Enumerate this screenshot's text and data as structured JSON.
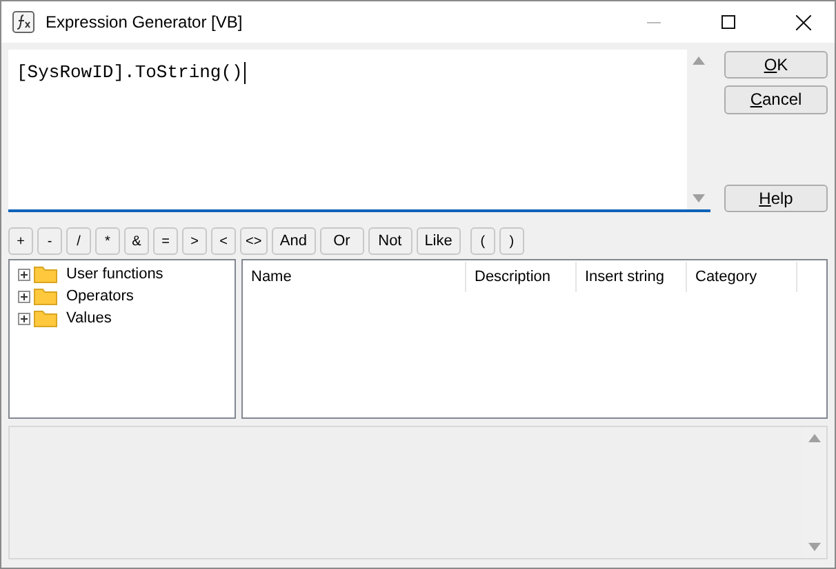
{
  "window": {
    "title": "Expression Generator [VB]"
  },
  "editor": {
    "value": "[SysRowID].ToString()"
  },
  "buttons": [
    {
      "key": "O",
      "after": "K"
    },
    {
      "key": "C",
      "after": "ancel"
    },
    {
      "key": "H",
      "after": "elp"
    }
  ],
  "operators": [
    {
      "label": "+",
      "kind": "narrow"
    },
    {
      "label": "-",
      "kind": "narrow"
    },
    {
      "label": "/",
      "kind": "narrow"
    },
    {
      "label": "*",
      "kind": "narrow"
    },
    {
      "label": "&",
      "kind": "narrow"
    },
    {
      "label": "=",
      "kind": "narrow"
    },
    {
      "label": ">",
      "kind": "narrow"
    },
    {
      "label": "<",
      "kind": "narrow"
    },
    {
      "label": "<>",
      "kind": "narrow"
    },
    {
      "label": "And",
      "kind": "wide"
    },
    {
      "label": "Or",
      "kind": "wide"
    },
    {
      "label": "Not",
      "kind": "wide"
    },
    {
      "label": "Like",
      "kind": "wide"
    },
    {
      "label": "(",
      "kind": "paren"
    },
    {
      "label": ")",
      "kind": "narrow"
    }
  ],
  "tree": [
    {
      "label": "User functions",
      "expanded": false
    },
    {
      "label": "Operators",
      "expanded": false
    },
    {
      "label": "Values",
      "expanded": false
    }
  ],
  "table": {
    "columns": [
      "Name",
      "Description",
      "Insert string",
      "Category"
    ]
  }
}
